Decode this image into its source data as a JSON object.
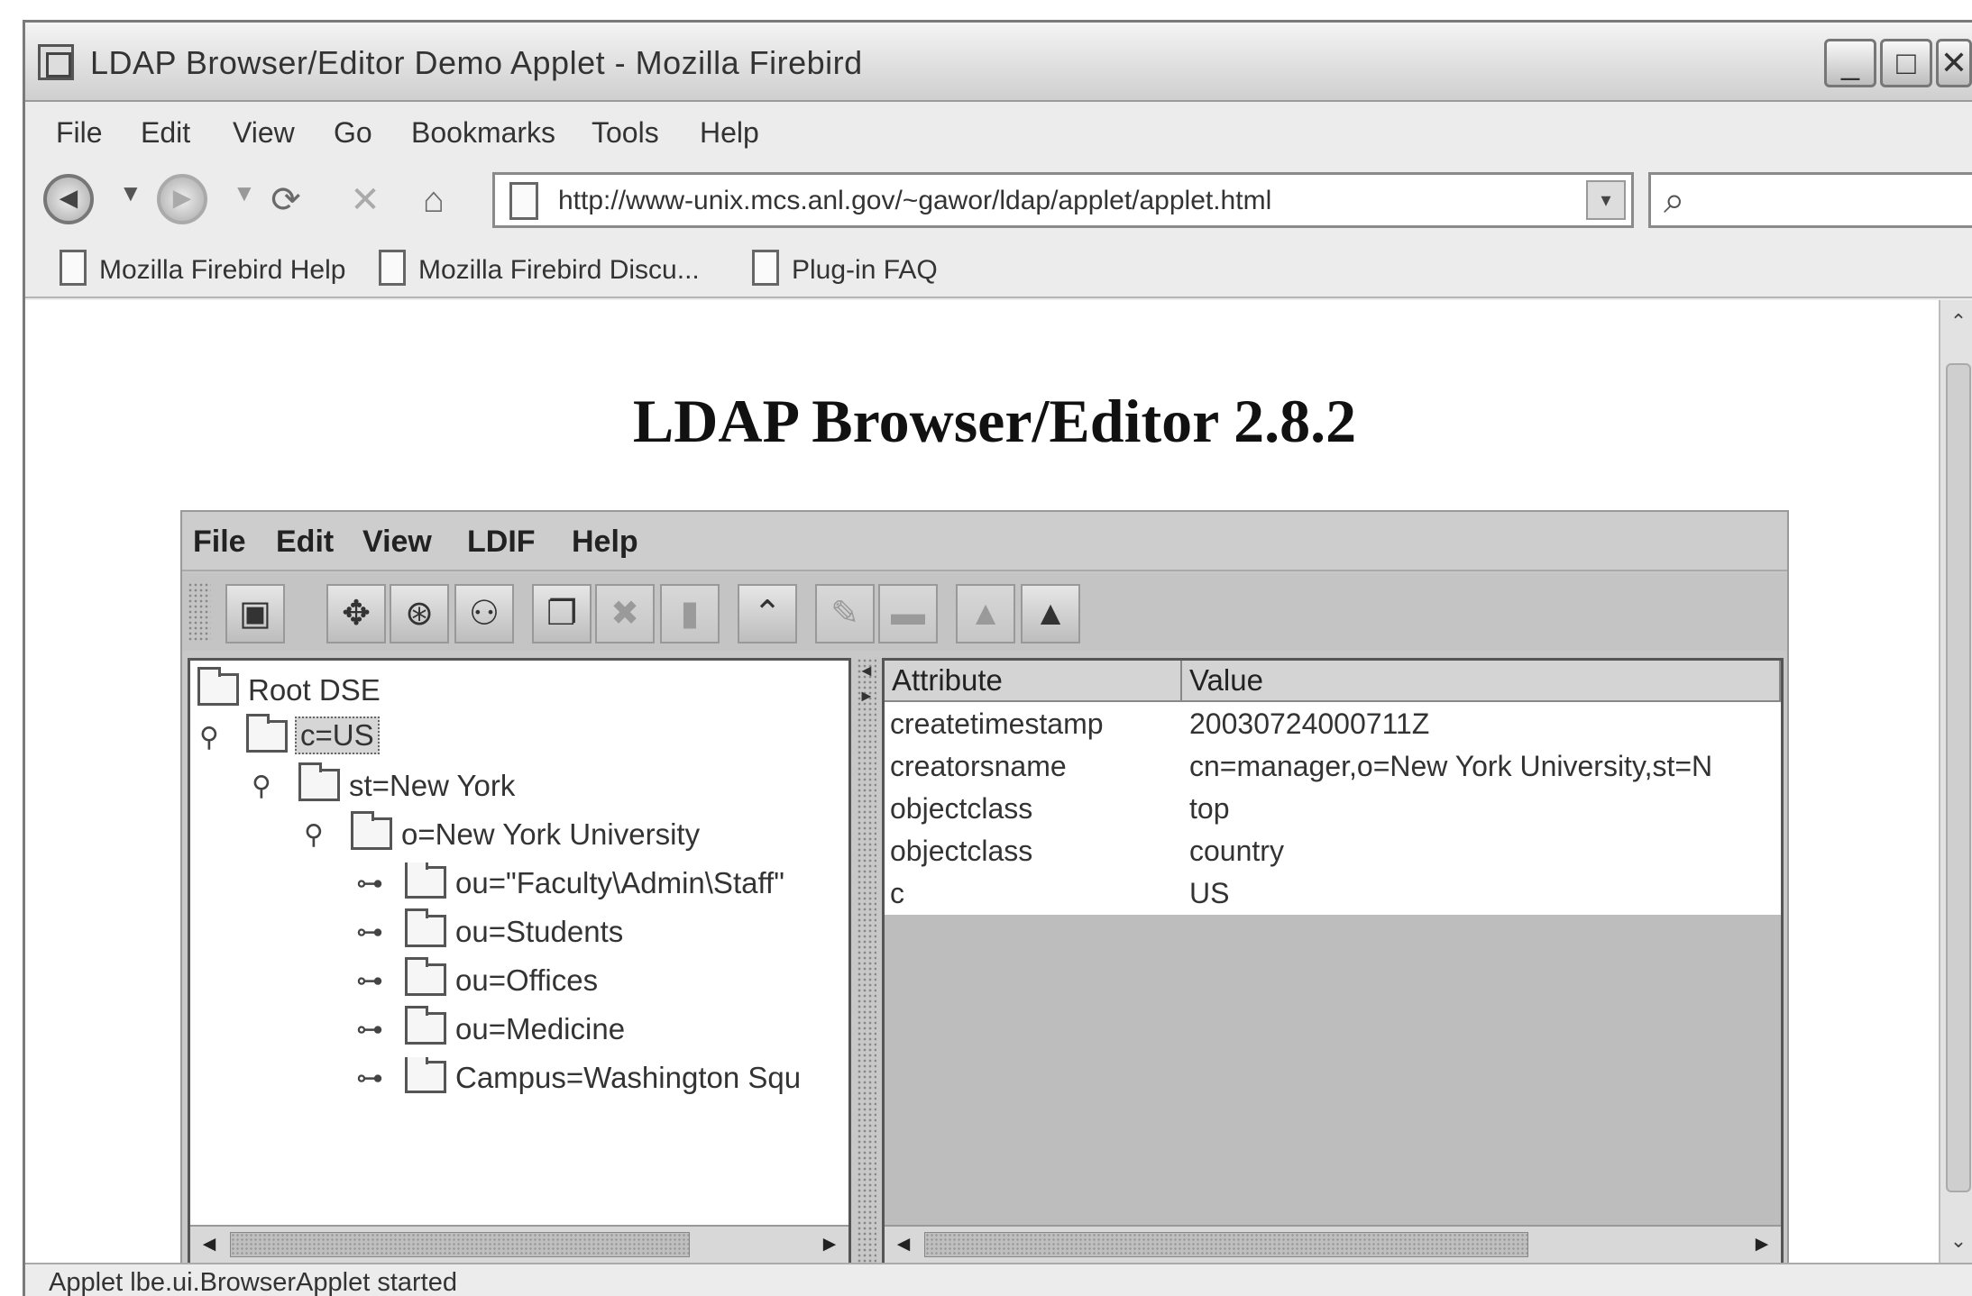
{
  "window": {
    "title": "LDAP Browser/Editor Demo Applet - Mozilla Firebird",
    "buttons": {
      "minimize": "_",
      "maximize": "□",
      "close": "✕"
    }
  },
  "browser_menu": [
    "File",
    "Edit",
    "View",
    "Go",
    "Bookmarks",
    "Tools",
    "Help"
  ],
  "navigation": {
    "back_icon": "◄",
    "forward_icon": "►",
    "dropdown_icon": "▼",
    "url": "http://www-unix.mcs.anl.gov/~gawor/ldap/applet/applet.html",
    "url_dropdown": "▾",
    "search_icon": "⌕",
    "search_placeholder": ""
  },
  "bookmarks": [
    "Mozilla Firebird Help",
    "Mozilla Firebird Discu...",
    "Plug-in FAQ"
  ],
  "page": {
    "heading": "LDAP Browser/Editor 2.8.2"
  },
  "applet": {
    "menu": [
      "File",
      "Edit",
      "View",
      "LDIF",
      "Help"
    ],
    "toolbar": [
      {
        "name": "connect",
        "glyph": "▣"
      },
      {
        "name": "refresh",
        "glyph": "✥"
      },
      {
        "name": "search-edit",
        "glyph": "⊛"
      },
      {
        "name": "find",
        "glyph": "⚇"
      },
      {
        "name": "copy",
        "glyph": "❐"
      },
      {
        "name": "cut",
        "glyph": "✖"
      },
      {
        "name": "paste",
        "glyph": "▮"
      },
      {
        "name": "up",
        "glyph": "⌃"
      },
      {
        "name": "edit",
        "glyph": "✎"
      },
      {
        "name": "delete",
        "glyph": "▬"
      },
      {
        "name": "export",
        "glyph": "▲"
      },
      {
        "name": "import",
        "glyph": "▲"
      }
    ],
    "tree": [
      {
        "label": "Root DSE",
        "handle": ""
      },
      {
        "label": "c=US",
        "handle": "⚲",
        "selected": true
      },
      {
        "label": "st=New York",
        "handle": "⚲"
      },
      {
        "label": "o=New York University",
        "handle": "⚲"
      },
      {
        "label": "ou=\"Faculty\\Admin\\Staff\"",
        "handle": "⊶"
      },
      {
        "label": "ou=Students",
        "handle": "⊶"
      },
      {
        "label": "ou=Offices",
        "handle": "⊶"
      },
      {
        "label": "ou=Medicine",
        "handle": "⊶"
      },
      {
        "label": "Campus=Washington Squ",
        "handle": "⊶"
      }
    ],
    "attributes": {
      "headers": [
        "Attribute",
        "Value"
      ],
      "rows": [
        [
          "createtimestamp",
          "20030724000711Z"
        ],
        [
          "creatorsname",
          "cn=manager,o=New York University,st=N"
        ],
        [
          "objectclass",
          "top"
        ],
        [
          "objectclass",
          "country"
        ],
        [
          "c",
          "US"
        ]
      ]
    },
    "scroll_left": "◄",
    "scroll_right": "►"
  },
  "status": "Applet lbe.ui.BrowserApplet started"
}
